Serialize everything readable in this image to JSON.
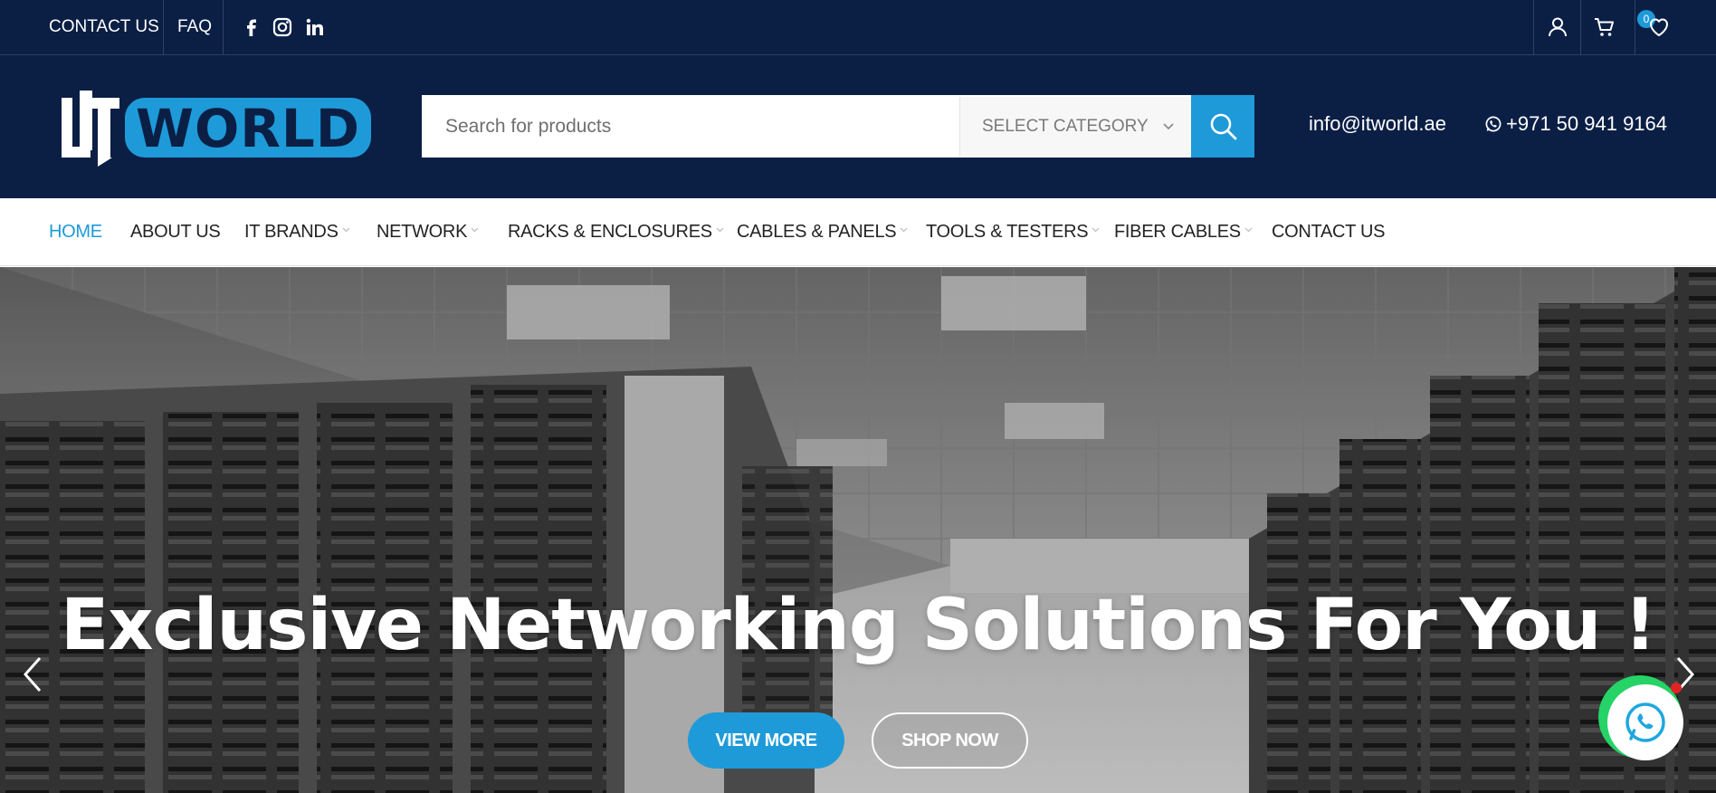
{
  "topbar": {
    "contact_label": "CONTACT US",
    "faq_label": "FAQ",
    "social": [
      "facebook-icon",
      "instagram-icon",
      "linkedin-icon"
    ],
    "cart_count": "0"
  },
  "header": {
    "logo_text": "IT WORLD",
    "search_placeholder": "Search for products",
    "category_label": "SELECT CATEGORY",
    "email": "info@itworld.ae",
    "phone": "+971 50 941 9164"
  },
  "nav": {
    "items": [
      {
        "label": "HOME"
      },
      {
        "label": "ABOUT US"
      },
      {
        "label": "IT BRANDS"
      },
      {
        "label": "NETWORK"
      },
      {
        "label": "RACKS & ENCLOSURES"
      },
      {
        "label": "CABLES & PANELS"
      },
      {
        "label": "TOOLS & TESTERS"
      },
      {
        "label": "FIBER CABLES"
      },
      {
        "label": "CONTACT US"
      }
    ]
  },
  "hero": {
    "title": "Exclusive Networking Solutions For You !",
    "view_more": "VIEW MORE",
    "shop_now": "SHOP NOW"
  },
  "colors": {
    "navy": "#0b1f45",
    "accent": "#1e9ad9",
    "whatsapp": "#25d366"
  }
}
